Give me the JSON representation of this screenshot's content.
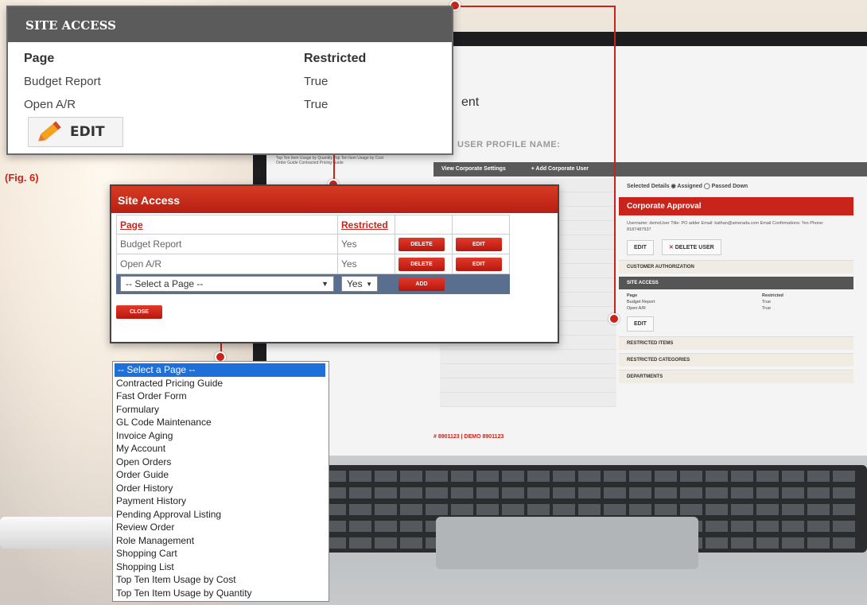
{
  "figure_label": "(Fig. 6)",
  "panel_view": {
    "title": "SITE ACCESS",
    "col_page": "Page",
    "col_restricted": "Restricted",
    "rows": [
      {
        "page": "Budget Report",
        "restricted": "True"
      },
      {
        "page": "Open A/R",
        "restricted": "True"
      }
    ],
    "edit_label": "EDIT"
  },
  "panel_edit": {
    "title": "Site Access",
    "col_page": "Page",
    "col_restricted": "Restricted",
    "rows": [
      {
        "page": "Budget Report",
        "restricted": "Yes",
        "delete": "DELETE",
        "edit": "EDIT"
      },
      {
        "page": "Open A/R",
        "restricted": "Yes",
        "delete": "DELETE",
        "edit": "EDIT"
      }
    ],
    "select_page_value": "-- Select a Page --",
    "select_restricted_value": "Yes",
    "add_label": "ADD",
    "close_label": "CLOSE"
  },
  "dropdown_options": [
    "-- Select a Page --",
    "Contracted Pricing Guide",
    "Fast Order Form",
    "Formulary",
    "GL Code Maintenance",
    "Invoice Aging",
    "My Account",
    "Open Orders",
    "Order Guide",
    "Order History",
    "Payment History",
    "Pending Approval Listing",
    "Review Order",
    "Role Management",
    "Shopping Cart",
    "Shopping List",
    "Top Ten Item Usage by Cost",
    "Top Ten Item Usage by Quantity"
  ],
  "laptop": {
    "title_fragment": "ent",
    "profile_label": "USER PROFILE NAME:",
    "left_items": "Top Ten Item Usage by Quantity Top Ten Item Usage by Cost Order Guide Contracted Pricing Guide",
    "bar_links": [
      "View Corporate Settings",
      "+ Add Corporate User"
    ],
    "selected_details": "Selected Details  ◉ Assigned  ◯ Passed Down",
    "approval_title": "Corporate Approval",
    "details": "Username: demoUser  Title: PO adder  Email: kathan@amerada.com  Email Confirmations: Yes  Phone: 8187487937",
    "edit_label": "EDIT",
    "delete_user_label": "DELETE USER",
    "customer_authorization": "CUSTOMER AUTHORIZATION",
    "site_access": "SITE ACCESS",
    "sa_head_page": "Page",
    "sa_head_restricted": "Restricted",
    "sa_rows": [
      {
        "page": "Budget Report",
        "restricted": "True"
      },
      {
        "page": "Open A/R",
        "restricted": "True"
      }
    ],
    "restricted_items": "RESTRICTED ITEMS",
    "restricted_categories": "RESTRICTED CATEGORIES",
    "departments": "DEPARTMENTS",
    "footer": "# 8901123 | DEMO 8901123"
  },
  "colors": {
    "accent": "#c9241b",
    "header_gray": "#5b5b5b",
    "select_row": "#5a6f8f",
    "dropdown_selected": "#1e6fd9"
  }
}
